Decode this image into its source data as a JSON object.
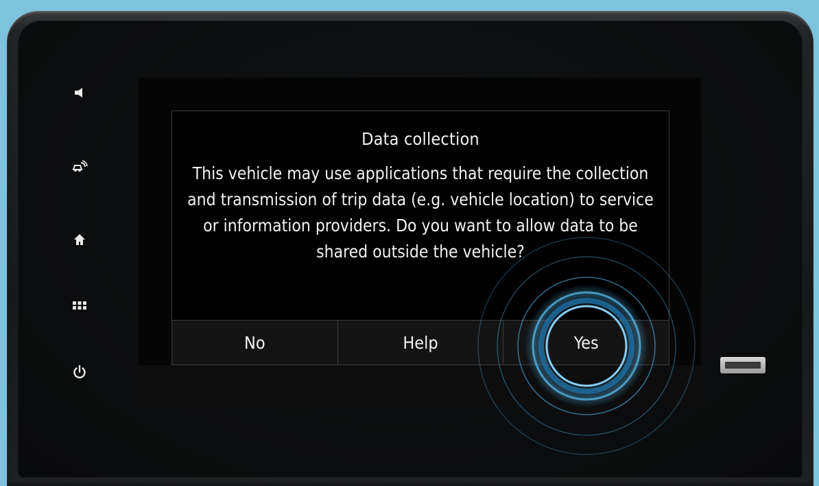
{
  "dialog": {
    "title": "Data collection",
    "body": "This vehicle may use applications that require the collection and transmission of trip data (e.g. vehicle location) to service or information providers. Do you want to allow data to be shared outside the vehicle?",
    "buttons": {
      "no": "No",
      "help": "Help",
      "yes": "Yes"
    }
  },
  "hardware_buttons": [
    {
      "icon": "volume-icon"
    },
    {
      "icon": "driving-assist-icon"
    },
    {
      "icon": "home-icon"
    },
    {
      "icon": "apps-grid-icon"
    },
    {
      "icon": "power-icon"
    }
  ],
  "colors": {
    "background": "#7ec3de",
    "dialog_background": "#000000",
    "button_bar": "#141414",
    "text": "#f2f2f2",
    "touch_ripple": "#4fb3e8"
  }
}
